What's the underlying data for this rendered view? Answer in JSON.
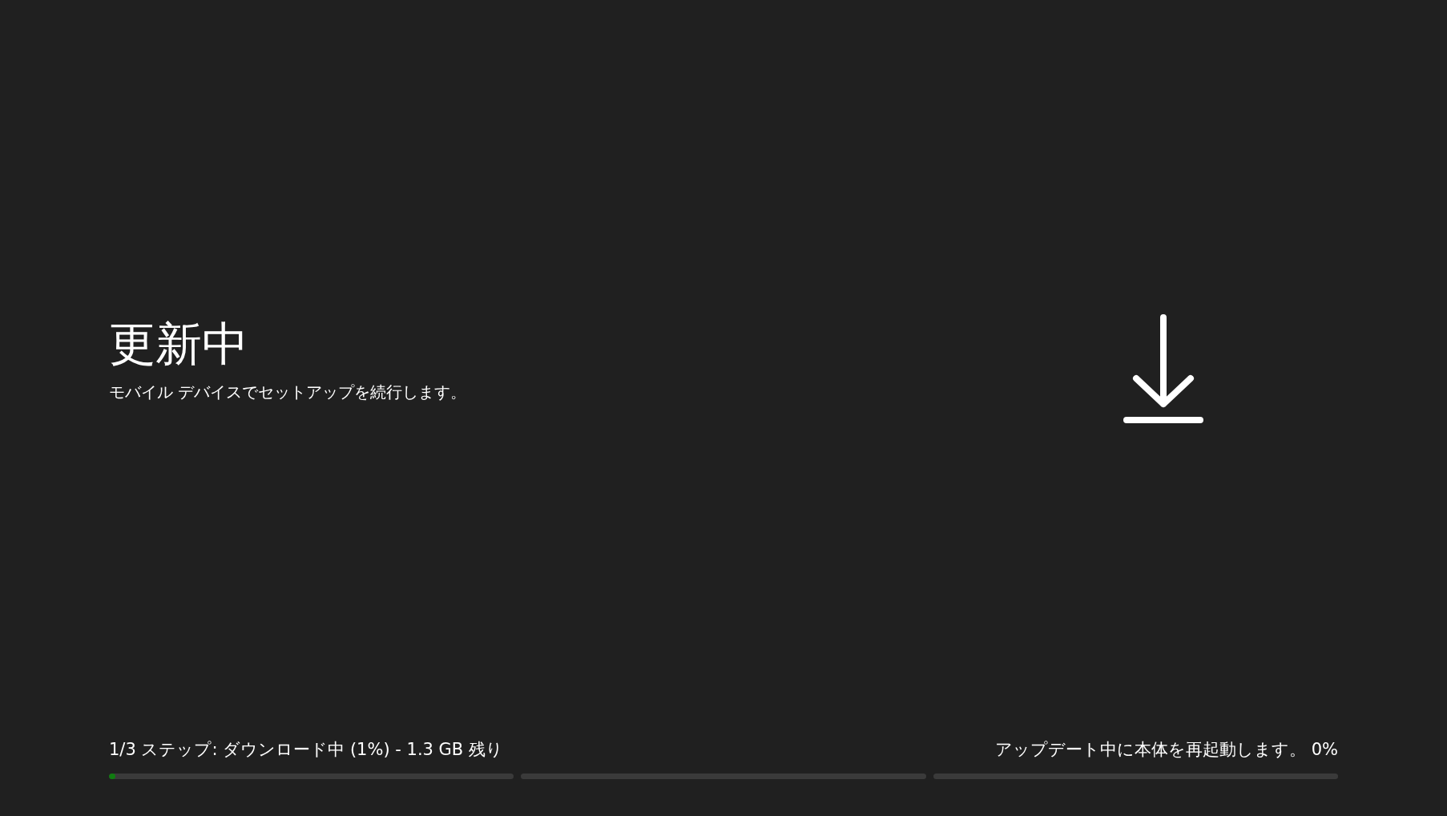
{
  "title": "更新中",
  "subtitle": "モバイル デバイスでセットアップを続行します。",
  "status_left": "1/3 ステップ: ダウンロード中 (1%) - 1.3 GB 残り",
  "status_right": "アップデート中に本体を再起動します。 0%",
  "progress": {
    "level": 0.01
  }
}
